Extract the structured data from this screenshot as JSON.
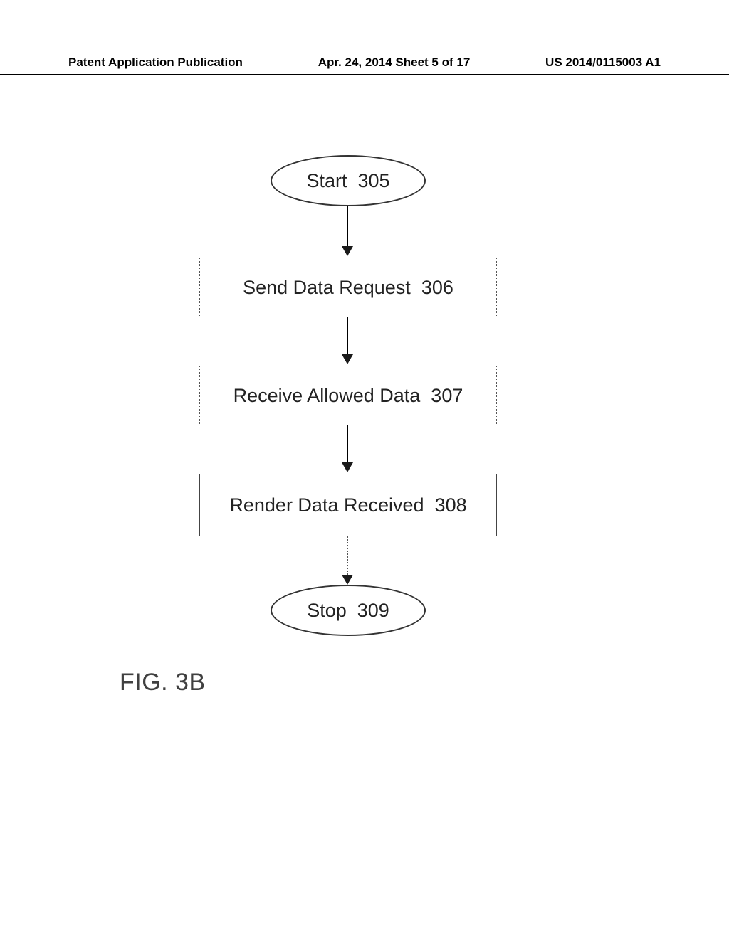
{
  "header": {
    "left": "Patent Application Publication",
    "center": "Apr. 24, 2014  Sheet 5 of 17",
    "right": "US 2014/0115003 A1"
  },
  "flow": {
    "start": {
      "label": "Start",
      "num": "305"
    },
    "step1": {
      "label": "Send Data Request",
      "num": "306"
    },
    "step2": {
      "label": "Receive Allowed Data",
      "num": "307"
    },
    "step3": {
      "label": "Render Data Received",
      "num": "308"
    },
    "stop": {
      "label": "Stop",
      "num": "309"
    }
  },
  "figure_label": "FIG. 3B"
}
